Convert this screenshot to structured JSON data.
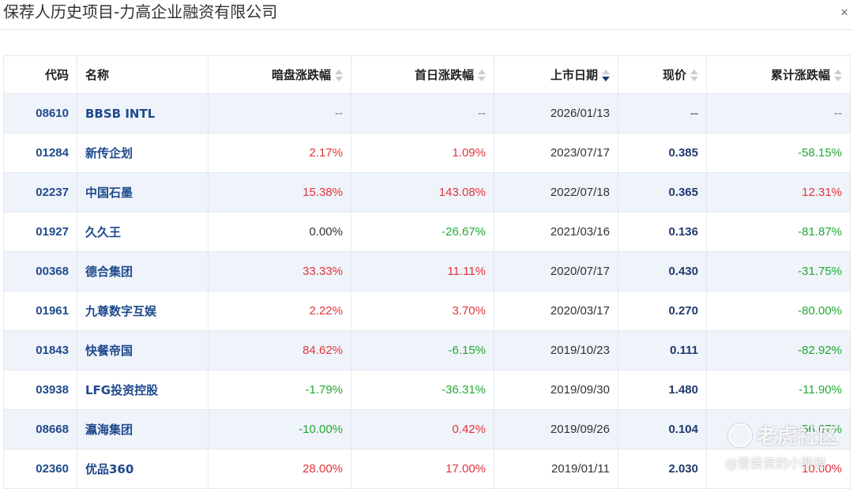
{
  "dialog": {
    "title": "保荐人历史项目-力高企业融资有限公司",
    "close_glyph": "×"
  },
  "table": {
    "columns": [
      {
        "label": "代码",
        "sortable": false
      },
      {
        "label": "名称",
        "sortable": false
      },
      {
        "label": "暗盘涨跌幅",
        "sortable": true
      },
      {
        "label": "首日涨跌幅",
        "sortable": true
      },
      {
        "label": "上市日期",
        "sortable": true,
        "sort": "desc"
      },
      {
        "label": "现价",
        "sortable": true
      },
      {
        "label": "累计涨跌幅",
        "sortable": true
      }
    ],
    "rows": [
      {
        "code": "08610",
        "name": "BBSB INTL",
        "grey": "--",
        "first": "--",
        "date": "2026/01/13",
        "price": "--",
        "cum": "--"
      },
      {
        "code": "01284",
        "name": "新传企划",
        "grey": "2.17%",
        "first": "1.09%",
        "date": "2023/07/17",
        "price": "0.385",
        "cum": "-58.15%"
      },
      {
        "code": "02237",
        "name": "中国石墨",
        "grey": "15.38%",
        "first": "143.08%",
        "date": "2022/07/18",
        "price": "0.365",
        "cum": "12.31%"
      },
      {
        "code": "01927",
        "name": "久久王",
        "grey": "0.00%",
        "first": "-26.67%",
        "date": "2021/03/16",
        "price": "0.136",
        "cum": "-81.87%"
      },
      {
        "code": "00368",
        "name": "德合集团",
        "grey": "33.33%",
        "first": "11.11%",
        "date": "2020/07/17",
        "price": "0.430",
        "cum": "-31.75%"
      },
      {
        "code": "01961",
        "name": "九尊数字互娱",
        "grey": "2.22%",
        "first": "3.70%",
        "date": "2020/03/17",
        "price": "0.270",
        "cum": "-80.00%"
      },
      {
        "code": "01843",
        "name": "快餐帝国",
        "grey": "84.62%",
        "first": "-6.15%",
        "date": "2019/10/23",
        "price": "0.111",
        "cum": "-82.92%"
      },
      {
        "code": "03938",
        "name": "LFG投资控股",
        "grey": "-1.79%",
        "first": "-36.31%",
        "date": "2019/09/30",
        "price": "1.480",
        "cum": "-11.90%"
      },
      {
        "code": "08668",
        "name": "瀛海集团",
        "grey": "-10.00%",
        "first": "0.42%",
        "date": "2019/09/26",
        "price": "0.104",
        "cum": "-56.67%"
      },
      {
        "code": "02360",
        "name": "优品360",
        "grey": "28.00%",
        "first": "17.00%",
        "date": "2019/01/11",
        "price": "2.030",
        "cum": "10.00%"
      }
    ]
  },
  "colors": {
    "up": "#e0353b",
    "down": "#22a833",
    "link": "#1f4a8c",
    "stripe": "#eff3fa"
  },
  "watermark": {
    "logo_text": "老虎社区",
    "user_text": "@爱投资的小熊猫"
  }
}
